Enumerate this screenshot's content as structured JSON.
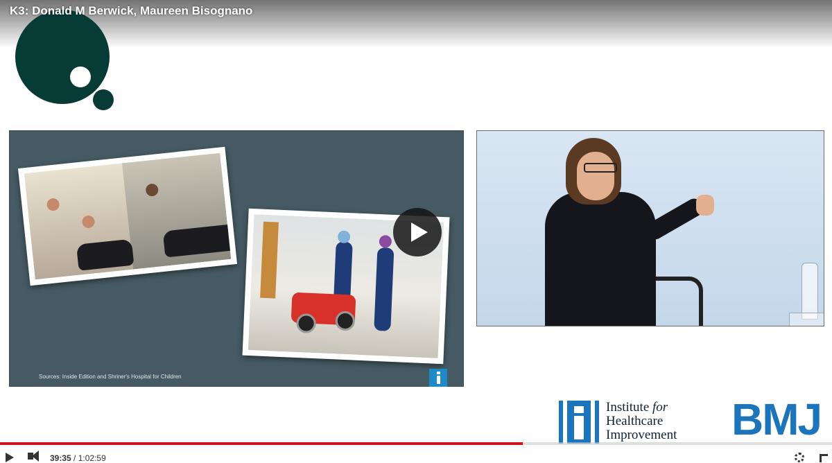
{
  "video": {
    "title": "K3: Donald M Berwick, Maureen Bisognano",
    "current_time": "39:35",
    "separator": "/",
    "duration": "1:02:59",
    "progress": 0.6286
  },
  "slide": {
    "source_text": "Sources: Inside Edition and Shriner's Hospital for Children"
  },
  "branding": {
    "ihi_line1": "Institute",
    "ihi_for": "for",
    "ihi_line2": "Healthcare",
    "ihi_line3": "Improvement",
    "bmj": "BMJ"
  },
  "icons": {
    "play_overlay": "play-icon",
    "play_control": "play-icon",
    "volume": "volume-icon",
    "settings": "gear-icon",
    "fullscreen": "fullscreen-icon"
  },
  "colors": {
    "progress": "#d0131b",
    "brand_blue": "#1b75bc",
    "logo_green": "#063b36",
    "slide_bg": "#455a63"
  }
}
